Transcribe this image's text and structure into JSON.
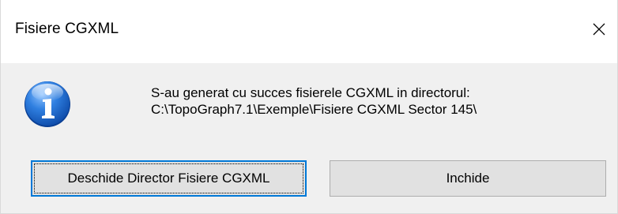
{
  "window": {
    "title": "Fisiere CGXML",
    "close_icon": "close-icon"
  },
  "message": {
    "icon": "info-icon",
    "line1": "S-au generat cu succes fisierele CGXML in directorul:",
    "line2": "C:\\TopoGraph7.1\\Exemple\\Fisiere CGXML Sector 145\\"
  },
  "buttons": {
    "open_directory": "Deschide Director Fisiere CGXML",
    "close": "Inchide"
  },
  "colors": {
    "accent": "#0078d7",
    "info_icon_blue": "#1d6fd1",
    "button_face": "#e1e1e1",
    "dialog_body": "#f0f0f0"
  }
}
